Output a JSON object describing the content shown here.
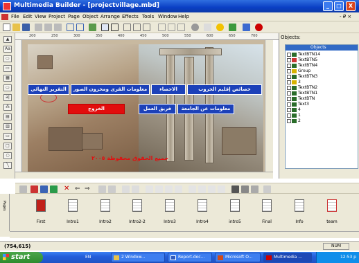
{
  "window": {
    "title": "Multimedia Builder - [projectvillage.mbd]",
    "min": "_",
    "max": "□",
    "close": "X"
  },
  "menu": [
    "File",
    "Edit",
    "View",
    "Project",
    "Page",
    "Object",
    "Arrange",
    "Effects",
    "Tools",
    "Window",
    "Help"
  ],
  "menu_right": "- ₽ ×",
  "ruler_marks": [
    "200",
    "250",
    "300",
    "350",
    "400",
    "450",
    "500",
    "550",
    "600",
    "650",
    "700"
  ],
  "stage": {
    "buttons": [
      {
        "label": "التقرير النهائي",
        "color": "#1c41b9"
      },
      {
        "label": "معلومات القرى ومخزون الصور",
        "color": "#1c41b9"
      },
      {
        "label": "الاحصاء",
        "color": "#1c41b9"
      },
      {
        "label": "خصائص إقليم الخروب",
        "color": "#1c41b9"
      },
      {
        "label": "فريق العمل",
        "color": "#1c41b9"
      },
      {
        "label": "معلومات عن الجامعة",
        "color": "#1c41b9"
      },
      {
        "label": "الخروج",
        "color": "#e20d0d"
      }
    ],
    "copyright": "جميع الحقوق محفوظة ٢٠٠٥"
  },
  "objects": {
    "label": "Objects:",
    "selected": "Objects",
    "items": [
      "TextBTN14",
      "TextBTN5",
      "TextBTN4",
      "Group",
      "TextBTN3",
      "3",
      "TextBTN2",
      "TextBTN1",
      "TextBTN",
      "Text3",
      "4",
      "1",
      "2"
    ]
  },
  "pages": {
    "side_label": "Pages",
    "items": [
      "First",
      "Intro1",
      "Intro2",
      "Intro2-2",
      "Intro3",
      "Intro4",
      "intro5",
      "Final",
      "Info",
      "team"
    ]
  },
  "status": {
    "coords": "(754,615)",
    "num": "NUM"
  },
  "taskbar": {
    "start": "start",
    "lang": "EN",
    "tasks": [
      "2 Window...",
      "Report.doc...",
      "Microsoft O...",
      "Multimedia ..."
    ],
    "clock": "12:53 p"
  }
}
